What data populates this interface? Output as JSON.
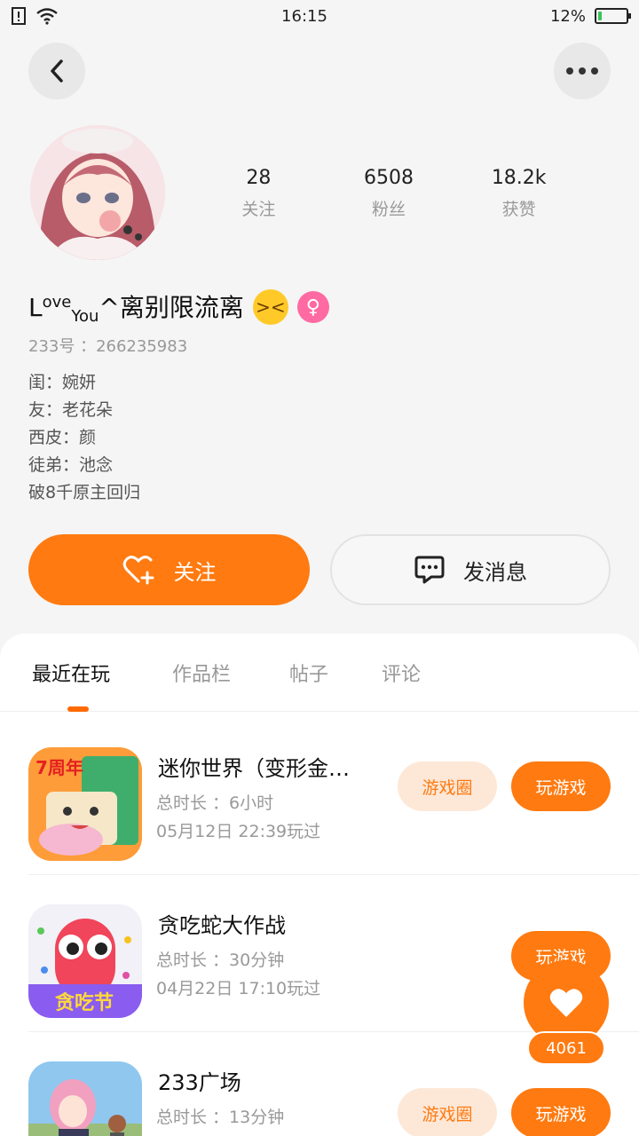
{
  "status_bar": {
    "time": "16:15",
    "battery": "12%",
    "battery_level": 0.12
  },
  "profile": {
    "stats": [
      {
        "value": "28",
        "label": "关注"
      },
      {
        "value": "6508",
        "label": "粉丝"
      },
      {
        "value": "18.2k",
        "label": "获赞"
      }
    ],
    "nickname_parts": {
      "a": "L",
      "b": "ove",
      "c": "You",
      "d": "^离别限流离"
    },
    "uid": "233号 ：266235983",
    "bio_lines": [
      "闺：婉妍",
      "友：老花朵",
      "西皮：颜",
      "徒弟：池念",
      "破8千原主回归"
    ]
  },
  "actions": {
    "follow_label": "关注",
    "message_label": "发消息"
  },
  "tabs": [
    {
      "label": "最近在玩",
      "active": true
    },
    {
      "label": "作品栏"
    },
    {
      "label": "帖子"
    },
    {
      "label": "评论"
    }
  ],
  "games": [
    {
      "name": "迷你世界（变形金…",
      "duration": "总时长 ：6小时",
      "played": "05月12日 22:39玩过",
      "circle_label": "游戏圈",
      "play_label": "玩游戏",
      "icon_badge": "7周年"
    },
    {
      "name": "贪吃蛇大作战",
      "duration": "总时长 ：30分钟",
      "played": "04月22日 17:10玩过",
      "play_label": "玩游戏",
      "icon_badge": "贪吃节"
    },
    {
      "name": "233广场",
      "duration": "总时长 ：13分钟",
      "circle_label": "游戏圈",
      "play_label": "玩游戏"
    }
  ],
  "like": {
    "count": "4061"
  },
  "colors": {
    "accent": "#ff7a10",
    "gender": "#ff6aa2"
  },
  "icons": [
    "back-icon",
    "more-icon",
    "wifi-icon",
    "sim-icon",
    "heart-plus-icon",
    "chat-icon",
    "heart-icon",
    "female-icon"
  ]
}
